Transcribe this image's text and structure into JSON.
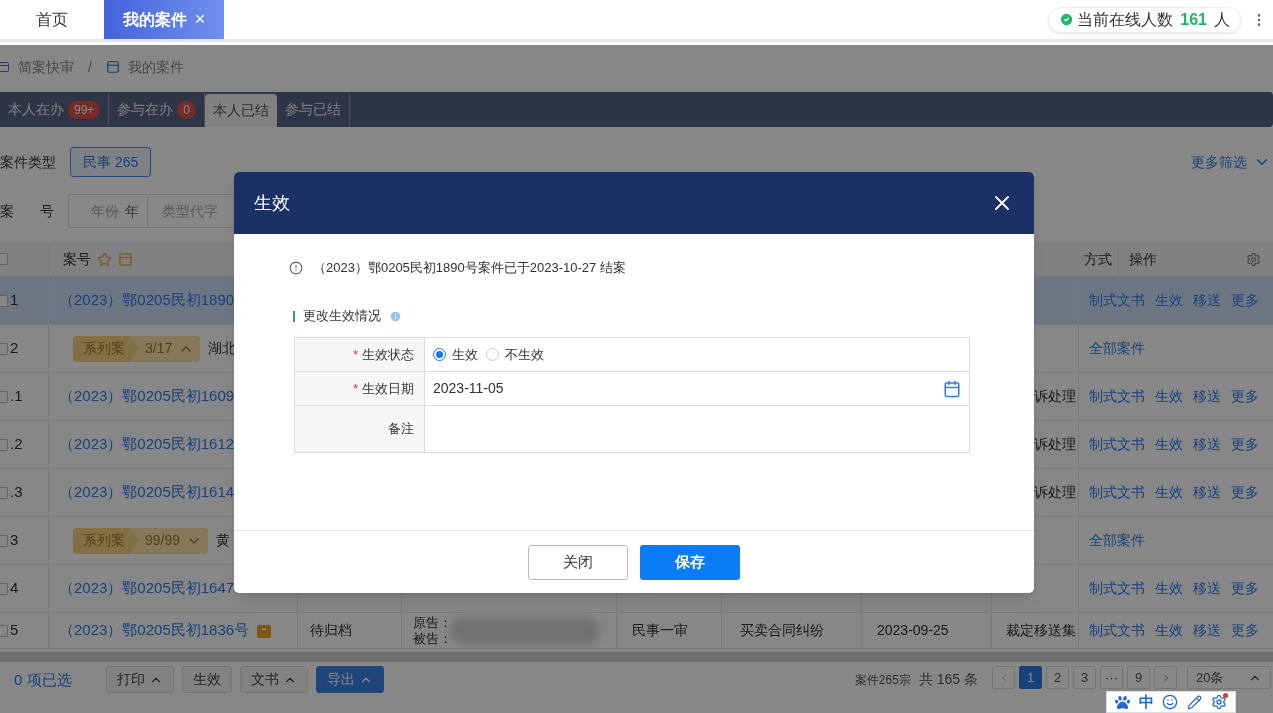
{
  "top_tabs": [
    {
      "label": "首页",
      "selected": false
    },
    {
      "label": "我的案件",
      "selected": true,
      "close": "×"
    }
  ],
  "online": {
    "label": "当前在线人数",
    "count": "161",
    "unit": "人"
  },
  "breadcrumb": {
    "items": [
      "简案快审",
      "我的案件"
    ],
    "separator": "/"
  },
  "case_tabs": [
    {
      "label": "本人在办",
      "badge": "99+",
      "selected": false
    },
    {
      "label": "参与在办",
      "badge": "0",
      "selected": false
    },
    {
      "label": "本人已结",
      "selected": true
    },
    {
      "label": "参与已结",
      "selected": false
    }
  ],
  "filters": {
    "case_type_label": "案件类型",
    "case_type_chip": "民事 265",
    "more": "更多筛选",
    "case_no_label": [
      "案",
      "号"
    ],
    "year_placeholder": "年份",
    "year_unit": "年",
    "type_code_placeholder": "类型代字"
  },
  "table": {
    "all_checked": false,
    "columns": {
      "case_no": "案号",
      "method": "方式",
      "actions": "操作"
    },
    "rows": [
      {
        "kind": "case",
        "index": "1",
        "case_no": "（2023）鄂0205民初1890",
        "highlighted": true,
        "checked": false,
        "actions": [
          "制式文书",
          "生效",
          "移送",
          "更多"
        ]
      },
      {
        "kind": "series",
        "index": "2",
        "series_label": "系列案",
        "series_count": "3/17",
        "expanded": true,
        "party": "湖北",
        "highlighted": false,
        "checked": false,
        "actions": [
          "全部案件"
        ]
      },
      {
        "kind": "case",
        "index": ".1",
        "case_no": "（2023）鄂0205民初1609",
        "method": "诉处理",
        "highlighted": false,
        "checked": false,
        "actions": [
          "制式文书",
          "生效",
          "移送",
          "更多"
        ]
      },
      {
        "kind": "case",
        "index": ".2",
        "case_no": "（2023）鄂0205民初1612",
        "method": "诉处理",
        "highlighted": false,
        "checked": false,
        "actions": [
          "制式文书",
          "生效",
          "移送",
          "更多"
        ]
      },
      {
        "kind": "case",
        "index": ".3",
        "case_no": "（2023）鄂0205民初1614",
        "method": "诉处理",
        "highlighted": false,
        "checked": false,
        "actions": [
          "制式文书",
          "生效",
          "移送",
          "更多"
        ]
      },
      {
        "kind": "series",
        "index": "3",
        "series_label": "系列案",
        "series_count": "99/99",
        "expanded": false,
        "party": "黄",
        "highlighted": false,
        "checked": false,
        "actions": [
          "全部案件"
        ]
      },
      {
        "kind": "case",
        "index": "4",
        "case_no": "（2023）鄂0205民初1647",
        "highlighted": false,
        "checked": false,
        "actions": [
          "制式文书",
          "生效",
          "移送",
          "更多"
        ]
      },
      {
        "kind": "case",
        "index": "5",
        "case_no": "（2023）鄂0205民初1836号",
        "tagged": true,
        "status": "待归档",
        "parties": [
          "原告：",
          "被告："
        ],
        "trial": "民事一审",
        "cause": "买卖合同纠纷",
        "date": "2023-09-25",
        "method": "裁定移送集",
        "highlighted": false,
        "checked": false,
        "actions": [
          "制式文书",
          "生效",
          "移送",
          "更多"
        ]
      }
    ]
  },
  "selection": "0 项已选",
  "bulk_buttons": [
    {
      "label": "打印",
      "dropdown": true,
      "primary": false
    },
    {
      "label": "生效",
      "dropdown": false,
      "primary": false
    },
    {
      "label": "文书",
      "dropdown": true,
      "primary": false
    },
    {
      "label": "导出",
      "dropdown": true,
      "primary": true
    }
  ],
  "pagination": {
    "summary": "案件265宗",
    "total": "共 165 条",
    "pages": [
      {
        "label": "1",
        "selected": true
      },
      {
        "label": "2",
        "selected": false
      },
      {
        "label": "3",
        "selected": false
      },
      {
        "label": "···",
        "selected": false
      },
      {
        "label": "9",
        "selected": false
      }
    ],
    "page_size": "20条"
  },
  "dialog": {
    "title": "生效",
    "notice": "（2023）鄂0205民初1890号案件已于2023-10-27 结案",
    "section": "更改生效情况",
    "required_mark": "*",
    "fields": [
      {
        "kind": "radio",
        "label": "生效状态",
        "required": true,
        "options": [
          {
            "label": "生效",
            "selected": true
          },
          {
            "label": "不生效",
            "selected": false
          }
        ]
      },
      {
        "kind": "date",
        "label": "生效日期",
        "required": true,
        "value": "2023-11-05"
      },
      {
        "kind": "textarea",
        "label": "备注",
        "required": false
      }
    ],
    "buttons": [
      {
        "label": "关闭",
        "primary": false
      },
      {
        "label": "保存",
        "primary": true
      }
    ]
  },
  "ime_toolbar": {
    "mode": "中"
  }
}
